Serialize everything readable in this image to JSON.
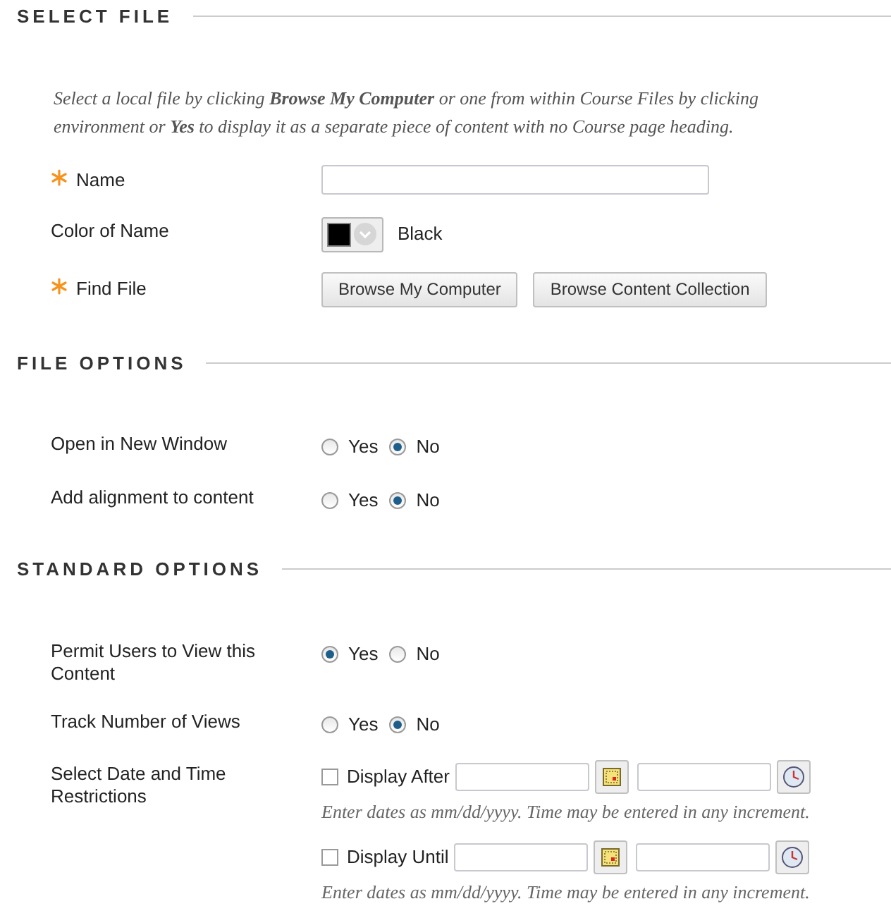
{
  "sections": [
    {
      "title": "SELECT FILE",
      "intro_lines": [
        "Select a local file by clicking **Browse My Computer** or one from within Course Files by clicking",
        "environment or **Yes** to display it as a separate piece of content with no Course page heading."
      ],
      "rows": [
        {
          "kind": "text",
          "label": "Name",
          "required": true
        },
        {
          "kind": "color",
          "label": "Color of Name",
          "required": false,
          "color": "#000000",
          "value": "Black"
        },
        {
          "kind": "buttons",
          "label": "Find File",
          "required": true,
          "buttons": [
            "Browse My Computer",
            "Browse Content Collection"
          ]
        }
      ]
    },
    {
      "title": "FILE OPTIONS",
      "rows": [
        {
          "kind": "radio",
          "label": "Open in New Window",
          "required": false,
          "options": [
            {
              "label": "Yes",
              "selected": false
            },
            {
              "label": "No",
              "selected": true
            }
          ]
        },
        {
          "kind": "radio",
          "label": "Add alignment to content",
          "required": false,
          "options": [
            {
              "label": "Yes",
              "selected": false
            },
            {
              "label": "No",
              "selected": true
            }
          ]
        }
      ]
    },
    {
      "title": "STANDARD OPTIONS",
      "rows": [
        {
          "kind": "radio",
          "label": "Permit Users to View this Content",
          "required": false,
          "options": [
            {
              "label": "Yes",
              "selected": true
            },
            {
              "label": "No",
              "selected": false
            }
          ]
        },
        {
          "kind": "radio",
          "label": "Track Number of Views",
          "required": false,
          "options": [
            {
              "label": "Yes",
              "selected": false
            },
            {
              "label": "No",
              "selected": true
            }
          ]
        },
        {
          "kind": "dates",
          "label": "Select Date and Time Restrictions",
          "required": false,
          "restrictions": [
            {
              "label": "Display After",
              "checked": false,
              "hint": "Enter dates as mm/dd/yyyy. Time may be entered in any increment."
            },
            {
              "label": "Display Until",
              "checked": false,
              "hint": "Enter dates as mm/dd/yyyy. Time may be entered in any increment."
            }
          ]
        }
      ]
    }
  ]
}
